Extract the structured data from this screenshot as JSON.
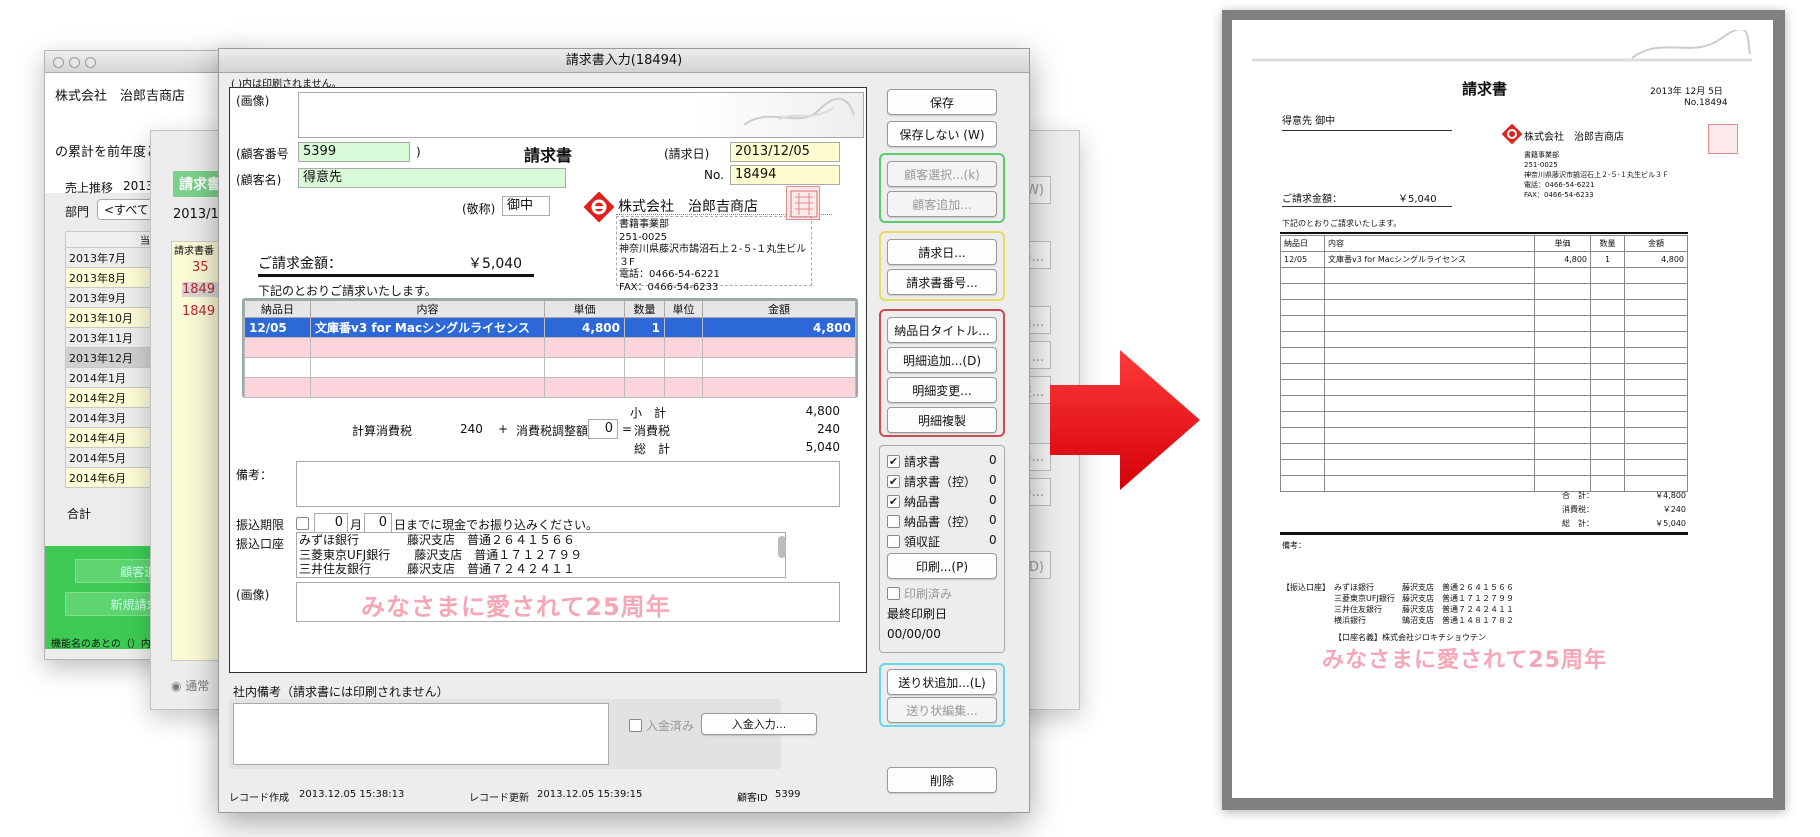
{
  "win1": {
    "company": "株式会社　治郎吉商店",
    "subtitle": "の累計を前年度と",
    "sales_label": "売上推移",
    "sales_year": "2013",
    "dept_label": "部門",
    "dept_select": "<すべて",
    "col_header": "当期",
    "months": [
      "2013年7月",
      "2013年8月",
      "2013年9月",
      "2013年10月",
      "2013年11月",
      "2013年12月",
      "2014年1月",
      "2014年2月",
      "2014年3月",
      "2014年4月",
      "2014年5月",
      "2014年6月"
    ],
    "total_label": "合計",
    "btn_customer_add": "顧客追加...",
    "btn_new_invoice": "新規請求書（F",
    "footer": "機能名のあとの（）内"
  },
  "win2": {
    "tag": "請求書",
    "year": "2013/1",
    "col_header": "請求書番",
    "numbers": [
      "35",
      "1849",
      "1849"
    ],
    "radio_label": "通常",
    "ghost_buttons": [
      "(W)",
      "書(N)...",
      "編集...",
      "カ...",
      "報...",
      "P)...",
      "(E)...",
      "一覧(D)"
    ]
  },
  "main": {
    "title": "請求書入力(18494)",
    "note_top": "( )内は印刷されません。",
    "image_label": "(画像)",
    "customer_no_label": "(顧客番号",
    "customer_no": "5399",
    "paren_close": ")",
    "doc_title": "請求書",
    "invoice_date_label": "(請求日)",
    "invoice_date": "2013/12/05",
    "no_label": "No.",
    "invoice_no": "18494",
    "customer_name_label": "(顧客名)",
    "customer_name": "得意先",
    "honorific_label": "(敬称)",
    "honorific": "御中",
    "company": "株式会社　治郎吉商店",
    "company_dept": "書籍事業部",
    "company_zip": "251-0025",
    "company_address": "神奈川県藤沢市鵠沼石上２-５-１丸生ビル３F",
    "company_tel": "電話：0466-54-6221",
    "company_fax": "FAX：0466-54-6233",
    "amount_label": "ご請求金額：",
    "amount": "￥5,040",
    "greeting": "下記のとおりご請求いたします。",
    "table_headers": [
      "納品日",
      "内容",
      "単価",
      "数量",
      "単位",
      "金額"
    ],
    "rows": [
      {
        "date": "12/05",
        "content": "文庫番v3 for Macシングルライセンス",
        "price": "4,800",
        "qty": "1",
        "unit": "",
        "amount": "4,800"
      }
    ],
    "subtotal_label": "小　計",
    "subtotal": "4,800",
    "tax_calc_label": "計算消費税",
    "tax_calc": "240",
    "plus": "+",
    "tax_adjust_label": "消費税調整額",
    "tax_adjust": "0",
    "equals": "=",
    "tax_label": "消費税",
    "tax": "240",
    "total_label": "総　計",
    "total": "5,040",
    "remarks_label": "備考：",
    "deadline_label": "振込期限",
    "deadline_month": "0",
    "month_unit": "月",
    "deadline_day": "0",
    "deadline_text": "日までに現金でお振り込みください。",
    "bank_label": "振込口座",
    "banks": [
      "みずほ銀行　　　　藤沢支店　普通２６４１５６６",
      "三菱東京UFJ銀行　　藤沢支店　普通１７１２７９９",
      "三井住友銀行　　　藤沢支店　普通７２４２４１１"
    ],
    "image2_label": "(画像)",
    "pink_text": "みなさまに愛されて25周年",
    "internal_note_label": "社内備考（請求書には印刷されません）",
    "paid_label": "入金済み",
    "payment_button": "入金入力...",
    "created_label": "レコード作成",
    "created": "2013.12.05 15:38:13",
    "updated_label": "レコード更新",
    "updated": "2013.12.05 15:39:15",
    "customer_id_label": "顧客ID",
    "customer_id": "5399",
    "buttons": {
      "save": "保存",
      "nosave": "保存しない (W)",
      "customer_select": "顧客選択...(k)",
      "customer_add": "顧客追加...",
      "invoice_date": "請求日...",
      "invoice_number": "請求書番号...",
      "delivery_title": "納品日タイトル...",
      "add_detail": "明細追加...(D)",
      "change_detail": "明細変更...",
      "copy_detail": "明細複製",
      "print": "印刷...(P)",
      "add_label": "送り状追加...(L)",
      "edit_label": "送り状編集...",
      "delete": "削除"
    },
    "print_options": [
      {
        "label": "請求書",
        "checked": true,
        "count": "0"
      },
      {
        "label": "請求書（控）",
        "checked": true,
        "count": "0"
      },
      {
        "label": "納品書",
        "checked": true,
        "count": "0"
      },
      {
        "label": "納品書（控）",
        "checked": false,
        "count": "0"
      },
      {
        "label": "領収証",
        "checked": false,
        "count": "0"
      }
    ],
    "printed_label": "印刷済み",
    "last_print_label": "最終印刷日",
    "last_print": "00/00/00",
    "colors": {
      "selected_row": "#2d68d8",
      "pink_row": "#fbd5db",
      "green_group": "#5cc96a",
      "yellow_group": "#e6dc62",
      "red_group": "#cc4a52",
      "cyan_group": "#67d7e9"
    }
  },
  "arrow": {
    "color": "#e8131b"
  },
  "doc": {
    "title": "請求書",
    "date": "2013年 12月 5日",
    "no": "No.18494",
    "customer": "得意先 御中",
    "company": "株式会社　治郎吉商店",
    "dept": "書籍事業部",
    "zip": "251-0025",
    "address": "神奈川県藤沢市鵠沼石上２-５-１丸生ビル３Ｆ",
    "tel": "電話：0466-54-6221",
    "fax": "FAX：0466-54-6233",
    "amount_label": "ご請求金額：",
    "amount": "￥5,040",
    "greeting": "下記のとおりご請求いたします。",
    "headers": [
      "納品日",
      "内容",
      "単価",
      "数量",
      "金額"
    ],
    "row": {
      "date": "12/05",
      "content": "文庫番v3 for Macシングルライセンス",
      "price": "4,800",
      "qty": "1",
      "amount": "4,800"
    },
    "subtotal_label": "合　計：",
    "subtotal": "￥4,800",
    "tax_label": "消費税：",
    "tax": "￥240",
    "total_label": "総　計：",
    "total": "￥5,040",
    "remarks_label": "備考：",
    "bank_label": "【振込口座】",
    "banks": [
      {
        "name": "みずほ銀行",
        "branch": "藤沢支店",
        "acct": "普通２６４１５６６"
      },
      {
        "name": "三菱東京UFJ銀行",
        "branch": "藤沢支店",
        "acct": "普通１７１２７９９"
      },
      {
        "name": "三井住友銀行",
        "branch": "藤沢支店",
        "acct": "普通７２４２４１１"
      },
      {
        "name": "横浜銀行",
        "branch": "鵠沼支店",
        "acct": "普通１４８１７８２"
      }
    ],
    "account_holder_label": "【口座名義】",
    "account_holder": "株式会社ジロキチショウテン",
    "pink_text": "みなさまに愛されて25周年"
  }
}
